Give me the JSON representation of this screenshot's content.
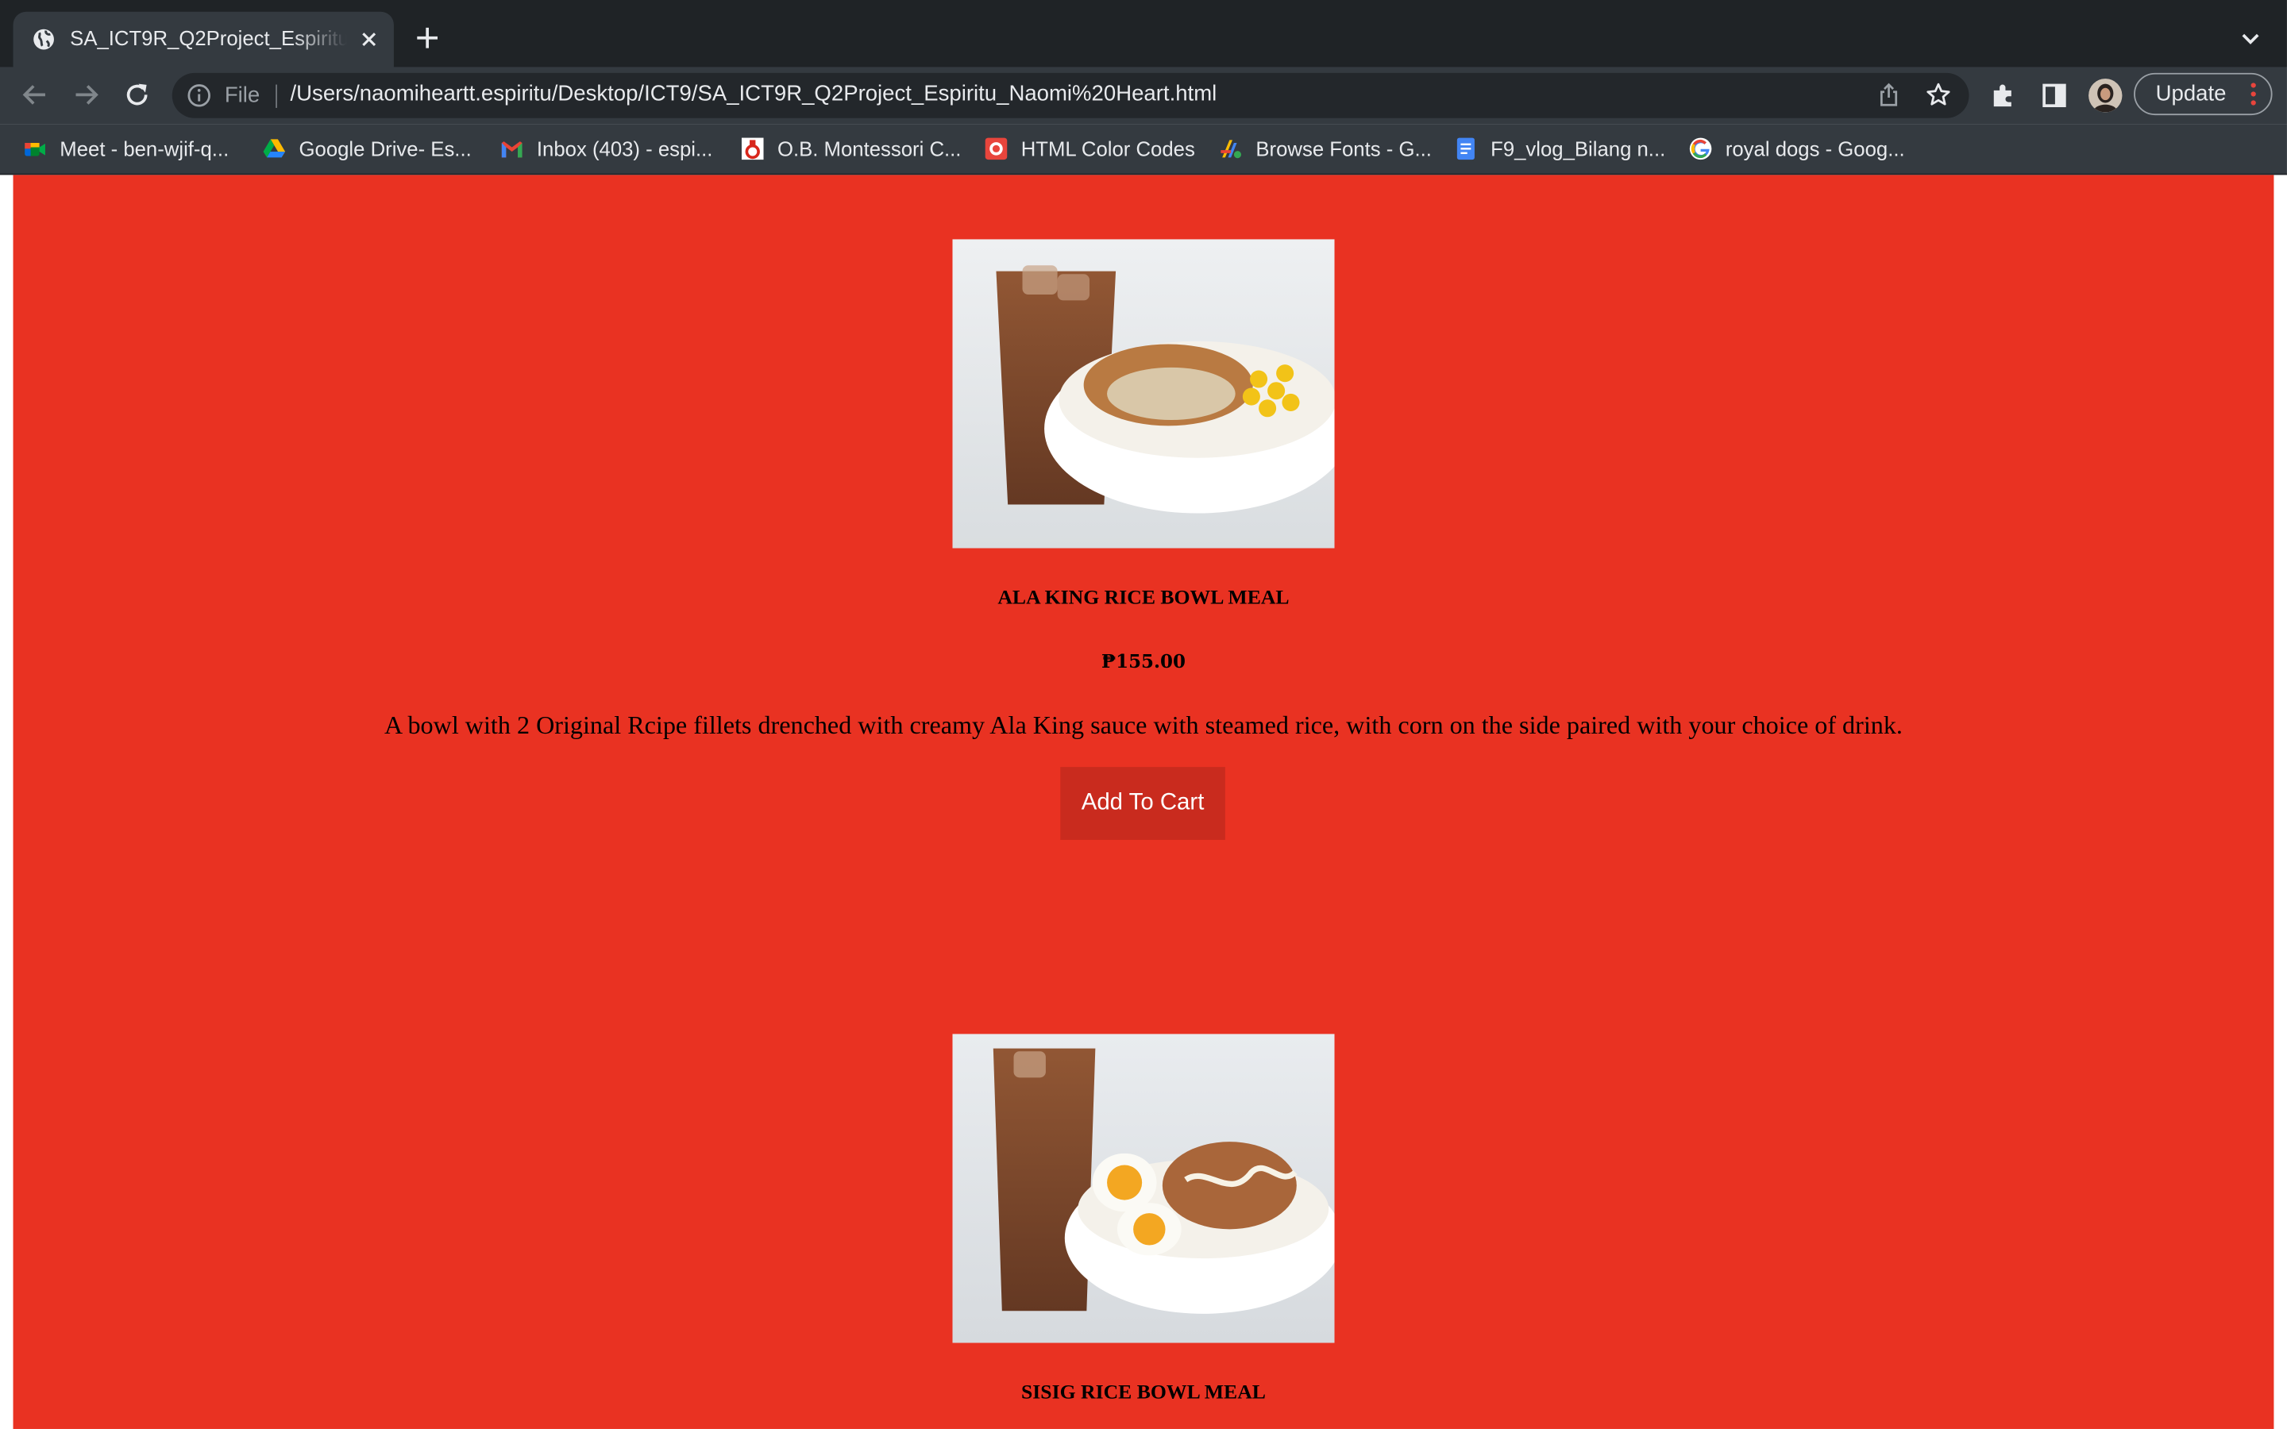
{
  "browser": {
    "tab": {
      "title": "SA_ICT9R_Q2Project_Espiritu_Naomi Heart"
    },
    "address": {
      "scheme_label": "File",
      "url": "/Users/naomiheartt.espiritu/Desktop/ICT9/SA_ICT9R_Q2Project_Espiritu_Naomi%20Heart.html"
    },
    "update_label": "Update",
    "bookmarks": [
      {
        "label": "Meet - ben-wjif-q...",
        "icon": "google-meet-icon"
      },
      {
        "label": "Google Drive- Es...",
        "icon": "google-drive-icon"
      },
      {
        "label": "Inbox (403) - espi...",
        "icon": "gmail-icon"
      },
      {
        "label": "O.B. Montessori C...",
        "icon": "school-icon"
      },
      {
        "label": "HTML Color Codes",
        "icon": "color-codes-icon"
      },
      {
        "label": "Browse Fonts - G...",
        "icon": "google-fonts-icon"
      },
      {
        "label": "F9_vlog_Bilang n...",
        "icon": "google-docs-icon"
      },
      {
        "label": "royal dogs - Goog...",
        "icon": "google-icon"
      }
    ]
  },
  "page": {
    "background": "#e93222",
    "products": [
      {
        "name": "ALA KING RICE BOWL MEAL",
        "price": "₱155.00",
        "description": "A bowl with 2 Original Rcipe fillets drenched with creamy Ala King sauce with steamed rice, with corn on the side paired with your choice of drink.",
        "button_label": "Add To Cart"
      },
      {
        "name": "SISIG RICE BOWL MEAL"
      }
    ]
  }
}
